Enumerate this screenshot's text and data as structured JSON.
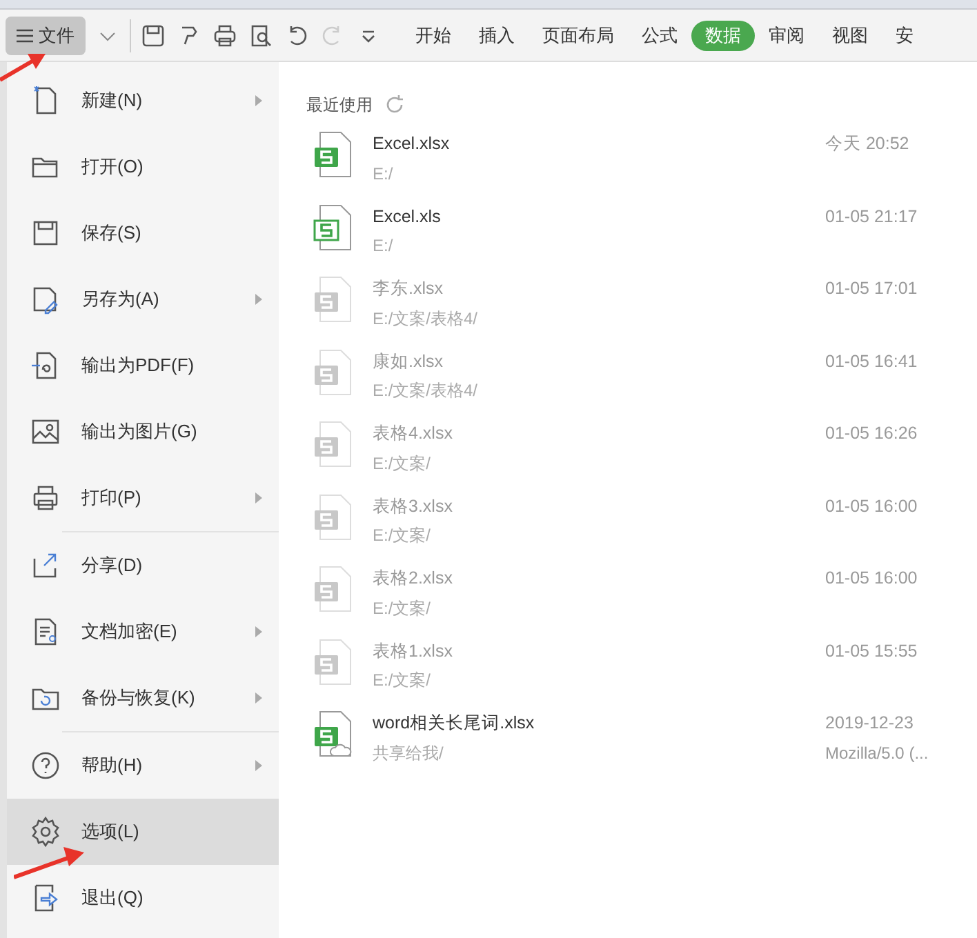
{
  "toolbar": {
    "file_menu": "文件",
    "tabs": [
      {
        "label": "开始",
        "selected": false
      },
      {
        "label": "插入",
        "selected": false
      },
      {
        "label": "页面布局",
        "selected": false
      },
      {
        "label": "公式",
        "selected": false
      },
      {
        "label": "数据",
        "selected": true
      },
      {
        "label": "审阅",
        "selected": false
      },
      {
        "label": "视图",
        "selected": false
      },
      {
        "label": "安",
        "selected": false
      }
    ]
  },
  "menu": {
    "groups": [
      [
        {
          "label": "新建(N)",
          "submenu": true,
          "selected": false
        },
        {
          "label": "打开(O)",
          "submenu": false,
          "selected": false
        },
        {
          "label": "保存(S)",
          "submenu": false,
          "selected": false
        },
        {
          "label": "另存为(A)",
          "submenu": true,
          "selected": false
        },
        {
          "label": "输出为PDF(F)",
          "submenu": false,
          "selected": false
        },
        {
          "label": "输出为图片(G)",
          "submenu": false,
          "selected": false
        },
        {
          "label": "打印(P)",
          "submenu": true,
          "selected": false
        }
      ],
      [
        {
          "label": "分享(D)",
          "submenu": false,
          "selected": false
        },
        {
          "label": "文档加密(E)",
          "submenu": true,
          "selected": false
        },
        {
          "label": "备份与恢复(K)",
          "submenu": true,
          "selected": false
        }
      ],
      [
        {
          "label": "帮助(H)",
          "submenu": true,
          "selected": false
        },
        {
          "label": "选项(L)",
          "submenu": false,
          "selected": true
        },
        {
          "label": "退出(Q)",
          "submenu": false,
          "selected": false
        }
      ]
    ]
  },
  "recent": {
    "title": "最近使用",
    "files": [
      {
        "name": "Excel.xlsx",
        "path": "E:/",
        "time": "今天 20:52",
        "kind": "xlsx",
        "available": true
      },
      {
        "name": "Excel.xls",
        "path": "E:/",
        "time": "01-05 21:17",
        "kind": "xls",
        "available": true
      },
      {
        "name": "李东.xlsx",
        "path": "E:/文案/表格4/",
        "time": "01-05 17:01",
        "kind": "xlsx",
        "available": false
      },
      {
        "name": "康如.xlsx",
        "path": "E:/文案/表格4/",
        "time": "01-05 16:41",
        "kind": "xlsx",
        "available": false
      },
      {
        "name": "表格4.xlsx",
        "path": "E:/文案/",
        "time": "01-05 16:26",
        "kind": "xlsx",
        "available": false
      },
      {
        "name": "表格3.xlsx",
        "path": "E:/文案/",
        "time": "01-05 16:00",
        "kind": "xlsx",
        "available": false
      },
      {
        "name": "表格2.xlsx",
        "path": "E:/文案/",
        "time": "01-05 16:00",
        "kind": "xlsx",
        "available": false
      },
      {
        "name": "表格1.xlsx",
        "path": "E:/文案/",
        "time": "01-05 15:55",
        "kind": "xlsx",
        "available": false
      },
      {
        "name": "word相关长尾词.xlsx",
        "path": "共享给我/",
        "time": "2019-12-23",
        "time_detail": "Mozilla/5.0 (...",
        "kind": "cloud",
        "available": true
      }
    ]
  }
}
